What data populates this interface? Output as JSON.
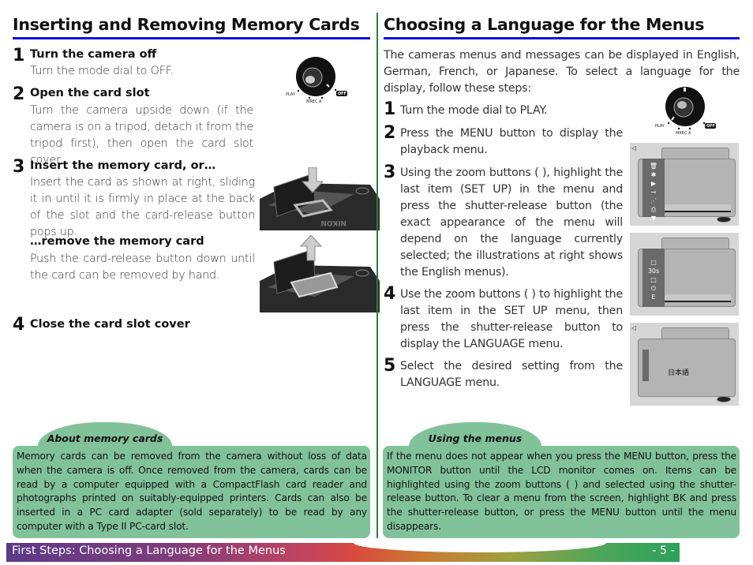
{
  "left": {
    "title": "Inserting and Removing Memory Cards",
    "steps": [
      {
        "num": "1",
        "title": "Turn the camera off",
        "body": "Turn the mode dial to OFF."
      },
      {
        "num": "2",
        "title": "Open the card slot",
        "body": "Turn the camera upside down (if the camera is on a tripod, detach it from the tripod first), then open the card slot cover."
      },
      {
        "num": "3",
        "title": "Insert the memory card, or…",
        "body": "Insert the card as shown at right, sliding it in until it is firmly in place at the back of the slot and the card-release button pops up."
      },
      {
        "num": "",
        "title": "…remove the memory card",
        "body": "Push the card-release button down until the card can be removed by hand."
      },
      {
        "num": "4",
        "title": "Close the card slot cover",
        "body": ""
      }
    ],
    "dial_labels": {
      "play": "PLAY",
      "rec": "MREC A",
      "off": "OFF"
    },
    "illustration_brand": "NIKON",
    "note": {
      "title": "About memory cards",
      "body": "Memory cards can be removed from the camera without loss of data when the camera is off.  Once removed from the camera, cards can be read by a computer equipped with a CompactFlash card reader and photographs printed on suitably-equipped printers.  Cards can also be inserted in a PC card adapter (sold separately) to be read by any computer with a Type II PC-card slot."
    }
  },
  "right": {
    "title": "Choosing a Language for the Menus",
    "intro": "The cameras menus and messages can be displayed in English, German, French, or Japanese.  To select a language for the display, follow these steps:",
    "steps": [
      {
        "num": "1",
        "body": "Turn the mode dial to PLAY."
      },
      {
        "num": "2",
        "body": "Press the MENU button to display the playback menu."
      },
      {
        "num": "3",
        "body": "Using the zoom buttons (      ), highlight the last item (SET UP) in the menu and press the shutter-release button (the exact appearance of the menu will depend on the language currently selected; the illustrations at right shows the English menus)."
      },
      {
        "num": "4",
        "body": "Use the zoom buttons (      ) to highlight the last item in the SET UP menu, then press the shutter-release button to display the LANGUAGE menu."
      },
      {
        "num": "5",
        "body": "Select the desired setting from the LANGUAGE menu."
      }
    ],
    "dial_labels": {
      "play": "PLAY",
      "rec": "MREC A",
      "off": "OFF"
    },
    "lcd_playback": {
      "back": "◁",
      "icons": [
        "🗑",
        "✱",
        "▶",
        "⊸",
        "⋰",
        "⎙",
        "▼"
      ]
    },
    "lcd_setup": {
      "icons": [
        "□",
        "30s",
        "□",
        "⏻",
        "E"
      ]
    },
    "lcd_language": {
      "back": "◁",
      "option": "日本語"
    },
    "note": {
      "title": "Using the menus",
      "body": "If the menu does not appear when you press the MENU button, press the MONITOR button until the LCD monitor comes on.  Items can be highlighted using the zoom buttons (      ) and selected using the shutter-release button.  To clear a menu from the screen, highlight BK and press the shutter-release button, or press the MENU button until the menu disappears."
    }
  },
  "footer": {
    "title": "First Steps: Choosing a Language for the Menus",
    "page": "- 5 -"
  }
}
